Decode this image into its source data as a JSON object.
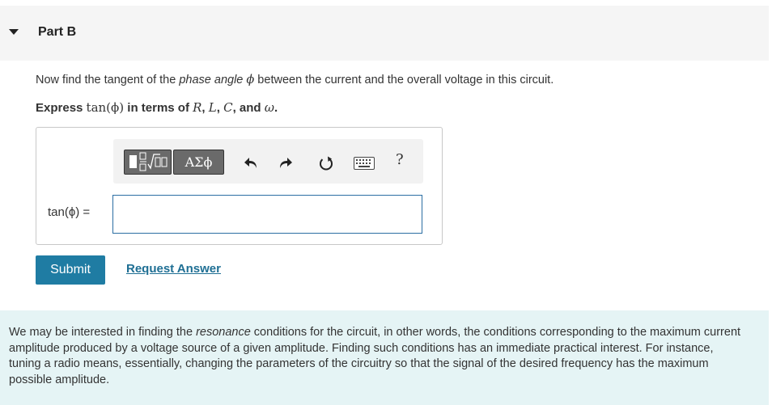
{
  "part": {
    "title": "Part B"
  },
  "prompt": {
    "line1_prefix": "Now find the tangent of the ",
    "line1_italic": "phase angle",
    "line1_symbol": "ϕ",
    "line1_suffix": " between the current and the overall voltage in this circuit.",
    "express_prefix": "Express ",
    "express_math": "tan(ϕ)",
    "express_middle": " in terms of ",
    "express_vars": [
      "R",
      "L",
      "C"
    ],
    "express_and": " and ",
    "express_last": "ω",
    "express_end": "."
  },
  "toolbar": {
    "templates_icon": "templates-icon",
    "greek_label": "ΑΣϕ",
    "undo_icon": "undo-icon",
    "redo_icon": "redo-icon",
    "reset_icon": "reset-icon",
    "keyboard_icon": "keyboard-icon",
    "help_label": "?"
  },
  "answer": {
    "label": "tan(ϕ) =",
    "value": ""
  },
  "actions": {
    "submit_label": "Submit",
    "request_label": "Request Answer"
  },
  "info": {
    "text_before": "We may be interested in finding the ",
    "text_italic": "resonance",
    "text_after": " conditions for the circuit, in other words, the conditions corresponding to the maximum current amplitude produced by a voltage source of a given amplitude. Finding such conditions has an immediate practical interest. For instance, tuning a radio means, essentially, changing the parameters of the circuitry so that the signal of the desired frequency has the maximum possible amplitude."
  },
  "colors": {
    "accent": "#1f7ca3",
    "link": "#1f6f94",
    "header_bg": "#f5f5f5",
    "info_bg": "#e5f4f5"
  }
}
